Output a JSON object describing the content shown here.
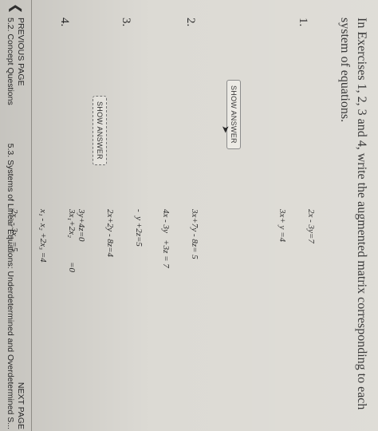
{
  "instructions": "In Exercises 1, 2, 3 and 4, write the augmented matrix corresponding to each system of equations.",
  "exercises": [
    {
      "number": "1.",
      "equations": [
        "2x - 3y=7",
        "3x+ y =4"
      ]
    },
    {
      "number": "2.",
      "equations": [
        "3x+7y - 8z= 5",
        "4x - 3y   +3z = 7"
      ]
    },
    {
      "number": "3.",
      "equations": [
        "-  y +2z=5",
        "2x+2y - 8z=4",
        "3y+4z=0"
      ]
    },
    {
      "number": "4.",
      "equations": [
        "3x₁+2x₂           =0",
        "x₁ - x₂ +2x₃ =4",
        "2x₂ - 3x₃ =5"
      ]
    }
  ],
  "buttons": {
    "show_answer_1": "SHOW ANSWER",
    "show_answer_2": "SHOW ANSWER"
  },
  "footer": {
    "prev_label": "PREVIOUS PAGE",
    "prev_title": "5.2. Concept Questions",
    "next_label": "NEXT PAGE",
    "next_title": "5.3. Systems of Linear Equations: Underdetermined and Overdetermined S..."
  }
}
